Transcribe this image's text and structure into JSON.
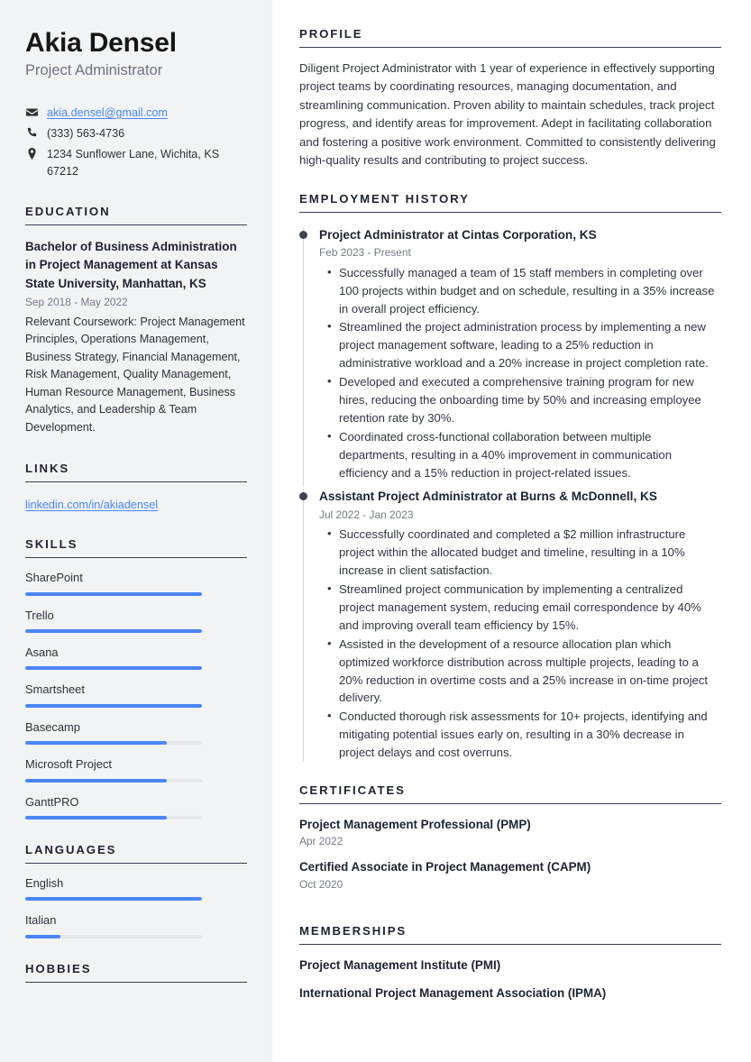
{
  "header": {
    "name": "Akia Densel",
    "job_title": "Project Administrator",
    "contact": {
      "email": "akia.densel@gmail.com",
      "phone": "(333) 563-4736",
      "address": "1234 Sunflower Lane, Wichita, KS 67212"
    }
  },
  "colors": {
    "accent_blue": "#4a86f7",
    "sidebar_bg": "#f2f3f5",
    "heading": "#1d2330",
    "body_text": "#30353f",
    "muted_text": "#737a86",
    "timeline_dot": "#3d4351",
    "bar_track": "#e6e7e9"
  },
  "sidebar": {
    "education": {
      "heading": "EDUCATION",
      "items": [
        {
          "degree": "Bachelor of Business Administration in Project Management at Kansas State University, Manhattan, KS",
          "date": "Sep 2018 - May 2022",
          "description": "Relevant Coursework: Project Management Principles, Operations Management, Business Strategy, Financial Management, Risk Management, Quality Management, Human Resource Management, Business Analytics, and Leadership & Team Development."
        }
      ]
    },
    "links": {
      "heading": "LINKS",
      "items": [
        {
          "label": "linkedin.com/in/akiadensel"
        }
      ]
    },
    "skills": {
      "heading": "SKILLS",
      "items": [
        {
          "label": "SharePoint",
          "level": 100
        },
        {
          "label": "Trello",
          "level": 100
        },
        {
          "label": "Asana",
          "level": 100
        },
        {
          "label": "Smartsheet",
          "level": 100
        },
        {
          "label": "Basecamp",
          "level": 80
        },
        {
          "label": "Microsoft Project",
          "level": 80
        },
        {
          "label": "GanttPRO",
          "level": 80
        }
      ]
    },
    "languages": {
      "heading": "LANGUAGES",
      "items": [
        {
          "label": "English",
          "level": 100
        },
        {
          "label": "Italian",
          "level": 20
        }
      ]
    },
    "hobbies": {
      "heading": "HOBBIES"
    }
  },
  "main": {
    "profile": {
      "heading": "PROFILE",
      "text": "Diligent Project Administrator with 1 year of experience in effectively supporting project teams by coordinating resources, managing documentation, and streamlining communication. Proven ability to maintain schedules, track project progress, and identify areas for improvement. Adept in facilitating collaboration and fostering a positive work environment. Committed to consistently delivering high-quality results and contributing to project success."
    },
    "employment": {
      "heading": "EMPLOYMENT HISTORY",
      "jobs": [
        {
          "title": "Project Administrator at Cintas Corporation, KS",
          "date": "Feb 2023 - Present",
          "bullets": [
            "Successfully managed a team of 15 staff members in completing over 100 projects within budget and on schedule, resulting in a 35% increase in overall project efficiency.",
            "Streamlined the project administration process by implementing a new project management software, leading to a 25% reduction in administrative workload and a 20% increase in project completion rate.",
            "Developed and executed a comprehensive training program for new hires, reducing the onboarding time by 50% and increasing employee retention rate by 30%.",
            "Coordinated cross-functional collaboration between multiple departments, resulting in a 40% improvement in communication efficiency and a 15% reduction in project-related issues."
          ]
        },
        {
          "title": "Assistant Project Administrator at Burns & McDonnell, KS",
          "date": "Jul 2022 - Jan 2023",
          "bullets": [
            "Successfully coordinated and completed a $2 million infrastructure project within the allocated budget and timeline, resulting in a 10% increase in client satisfaction.",
            "Streamlined project communication by implementing a centralized project management system, reducing email correspondence by 40% and improving overall team efficiency by 15%.",
            "Assisted in the development of a resource allocation plan which optimized workforce distribution across multiple projects, leading to a 20% reduction in overtime costs and a 25% increase in on-time project delivery.",
            "Conducted thorough risk assessments for 10+ projects, identifying and mitigating potential issues early on, resulting in a 30% decrease in project delays and cost overruns."
          ]
        }
      ]
    },
    "certificates": {
      "heading": "CERTIFICATES",
      "items": [
        {
          "title": "Project Management Professional (PMP)",
          "date": "Apr 2022"
        },
        {
          "title": "Certified Associate in Project Management (CAPM)",
          "date": "Oct 2020"
        }
      ]
    },
    "memberships": {
      "heading": "MEMBERSHIPS",
      "items": [
        {
          "title": "Project Management Institute (PMI)"
        },
        {
          "title": "International Project Management Association (IPMA)"
        }
      ]
    }
  }
}
